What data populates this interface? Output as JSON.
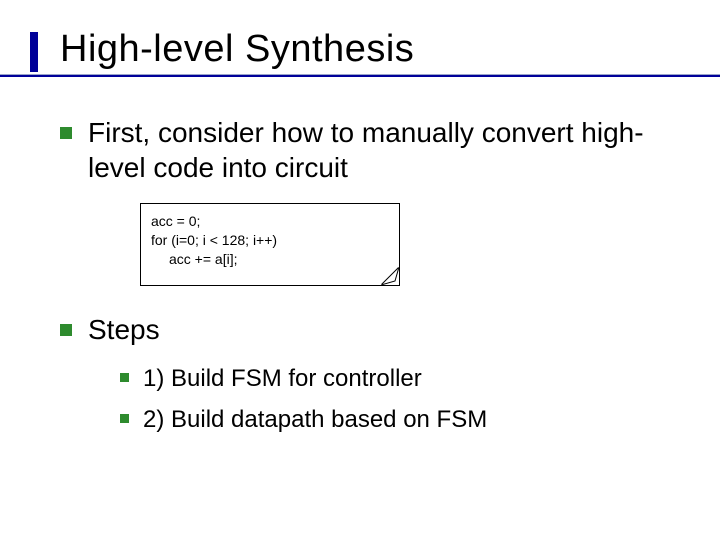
{
  "title": "High-level Synthesis",
  "bullets": {
    "intro": "First, consider how to manually convert high-level code into circuit",
    "steps_label": "Steps",
    "steps": [
      "1) Build FSM for controller",
      "2) Build datapath based on FSM"
    ]
  },
  "code": {
    "line1": "acc = 0;",
    "line2": "for (i=0; i < 128; i++)",
    "line3": "acc += a[i];"
  }
}
